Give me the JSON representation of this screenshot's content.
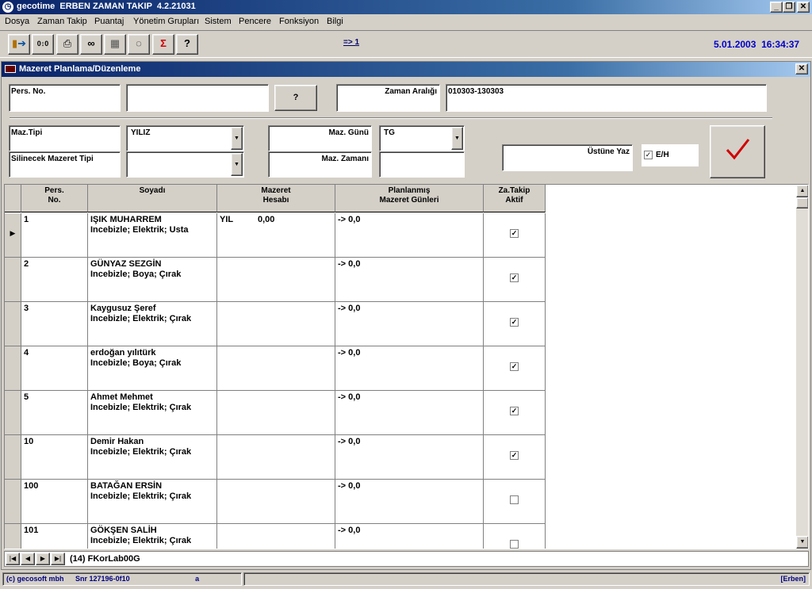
{
  "window": {
    "title": "gecotime  ERBEN ZAMAN TAKIP  4.2.21031"
  },
  "menu": [
    "Dosya",
    "Zaman Takip",
    "Puantaj",
    "Yönetim Grupları",
    "Sistem",
    "Pencere",
    "Fonksiyon",
    "Bilgi"
  ],
  "toolbar": {
    "icons": [
      "exit-icon",
      "compare-icon",
      "printer-icon",
      "binoculars-icon",
      "chart-icon",
      "chat-bubble-icon",
      "sigma-icon",
      "help-icon"
    ],
    "nav_indicator": "=> 1",
    "date": "5.01.2003",
    "time": "16:34:37"
  },
  "form": {
    "title": "Mazeret Planlama/Düzenleme",
    "pers_no_label": "Pers. No.",
    "pers_no_value": "",
    "name_value": "",
    "lookup_button": "?",
    "zaman_araligi_label": "Zaman Aralığı",
    "zaman_araligi_value": "010303-130303",
    "maz_tipi_label": "Maz.Tipi",
    "maz_tipi_value": "YILIZ",
    "silinecek_label": "Silinecek Mazeret Tipi",
    "silinecek_value": "",
    "maz_gunu_label": "Maz. Günü",
    "maz_gunu_value": "TG",
    "maz_zamani_label": "Maz. Zamanı",
    "maz_zamani_value": "",
    "ustune_yaz_label": "Üstüne Yaz",
    "eh_label": "E/H",
    "eh_checked": true,
    "check_color": "#d00000"
  },
  "grid": {
    "columns": [
      "Pers.\nNo.",
      "Soyadı",
      "Mazeret\nHesabı",
      "Planlanmış\nMazeret Günleri",
      "Za.Takip\nAktif"
    ],
    "rows": [
      {
        "no": "1",
        "name": "IŞIK MUHARREM",
        "detail": "Incebizle; Elektrik; Usta",
        "hesap_type": "YIL",
        "hesap_value": "0,00",
        "planned": "-> 0,0",
        "active": true,
        "current": true
      },
      {
        "no": "2",
        "name": "GÜNYAZ SEZGİN",
        "detail": "Incebizle; Boya; Çırak",
        "hesap_type": "",
        "hesap_value": "",
        "planned": "-> 0,0",
        "active": true,
        "current": false
      },
      {
        "no": "3",
        "name": "Kaygusuz Şeref",
        "detail": "Incebizle; Elektrik; Çırak",
        "hesap_type": "",
        "hesap_value": "",
        "planned": "-> 0,0",
        "active": true,
        "current": false
      },
      {
        "no": "4",
        "name": "erdoğan yılıtürk",
        "detail": "Incebizle; Boya; Çırak",
        "hesap_type": "",
        "hesap_value": "",
        "planned": "-> 0,0",
        "active": true,
        "current": false
      },
      {
        "no": "5",
        "name": "Ahmet Mehmet",
        "detail": "Incebizle; Elektrik; Çırak",
        "hesap_type": "",
        "hesap_value": "",
        "planned": "-> 0,0",
        "active": true,
        "current": false
      },
      {
        "no": "10",
        "name": "Demir Hakan",
        "detail": "Incebizle; Elektrik; Çırak",
        "hesap_type": "",
        "hesap_value": "",
        "planned": "-> 0,0",
        "active": true,
        "current": false
      },
      {
        "no": "100",
        "name": "BATAĞAN ERSİN",
        "detail": "Incebizle; Elektrik; Çırak",
        "hesap_type": "",
        "hesap_value": "",
        "planned": "-> 0,0",
        "active": false,
        "current": false
      },
      {
        "no": "101",
        "name": "GÖKŞEN SALİH",
        "detail": "Incebizle; Elektrik; Çırak",
        "hesap_type": "",
        "hesap_value": "",
        "planned": "-> 0,0",
        "active": false,
        "current": false
      }
    ]
  },
  "navigator": {
    "count": "(14)",
    "record": "FKorLab00G"
  },
  "status": {
    "copyright": "(c) gecosoft mbh",
    "serial": "Snr 127196-0f10",
    "mode": "a",
    "user": "[Erben]"
  }
}
